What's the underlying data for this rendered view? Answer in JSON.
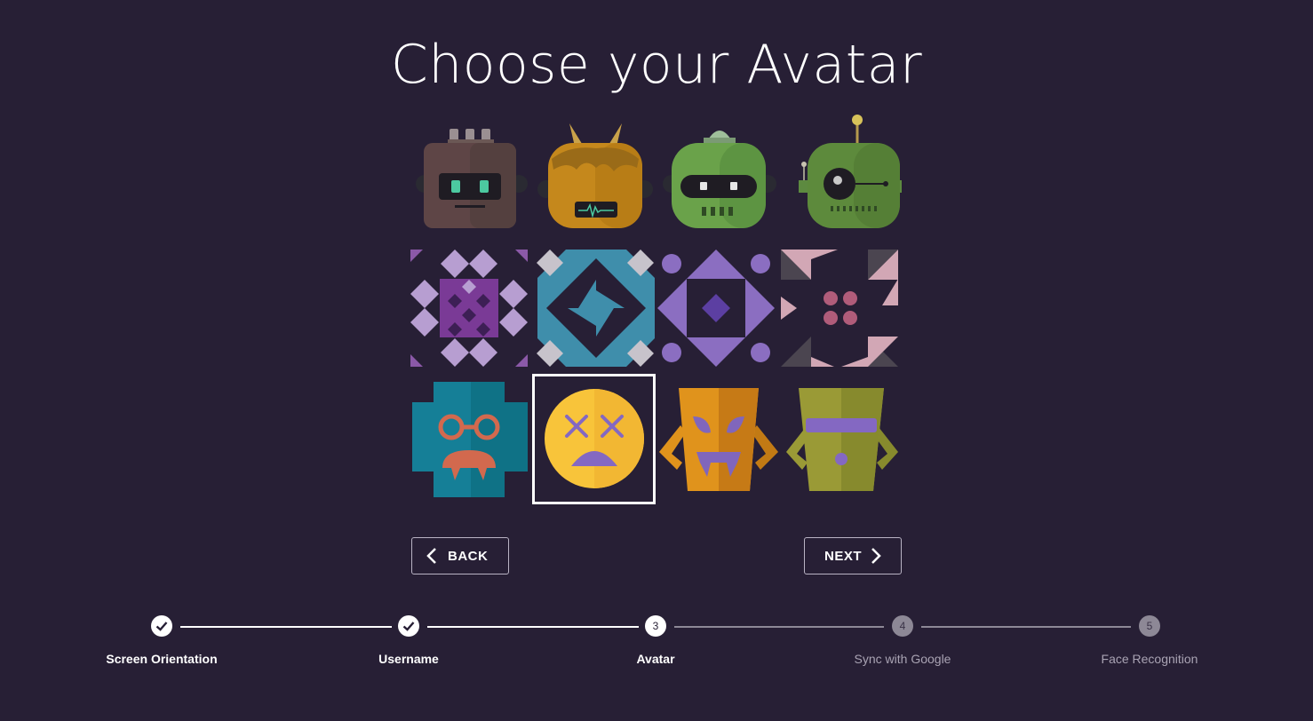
{
  "page": {
    "title": "Choose your Avatar"
  },
  "colors": {
    "background": "#271f35",
    "accent": "#ffffff",
    "pending_step": "#8d8896"
  },
  "avatars": [
    {
      "name": "robot-brown",
      "selected": false
    },
    {
      "name": "robot-horned-orange",
      "selected": false
    },
    {
      "name": "robot-green-dome",
      "selected": false
    },
    {
      "name": "robot-green-antenna",
      "selected": false
    },
    {
      "name": "pattern-purple-diamonds",
      "selected": false
    },
    {
      "name": "pattern-teal-pinwheel",
      "selected": false
    },
    {
      "name": "pattern-lavender-diamond",
      "selected": false
    },
    {
      "name": "pattern-dark-triangles",
      "selected": false
    },
    {
      "name": "monster-teal-glasses",
      "selected": false
    },
    {
      "name": "face-yellow-x-eyes",
      "selected": true
    },
    {
      "name": "mask-orange-tiki",
      "selected": false
    },
    {
      "name": "mask-olive-band",
      "selected": false
    }
  ],
  "navigation": {
    "back_label": "BACK",
    "next_label": "NEXT"
  },
  "stepper": {
    "steps": [
      {
        "number": "1",
        "label": "Screen Orientation",
        "state": "done"
      },
      {
        "number": "2",
        "label": "Username",
        "state": "done"
      },
      {
        "number": "3",
        "label": "Avatar",
        "state": "active"
      },
      {
        "number": "4",
        "label": "Sync with Google",
        "state": "pending"
      },
      {
        "number": "5",
        "label": "Face Recognition",
        "state": "pending"
      }
    ]
  }
}
